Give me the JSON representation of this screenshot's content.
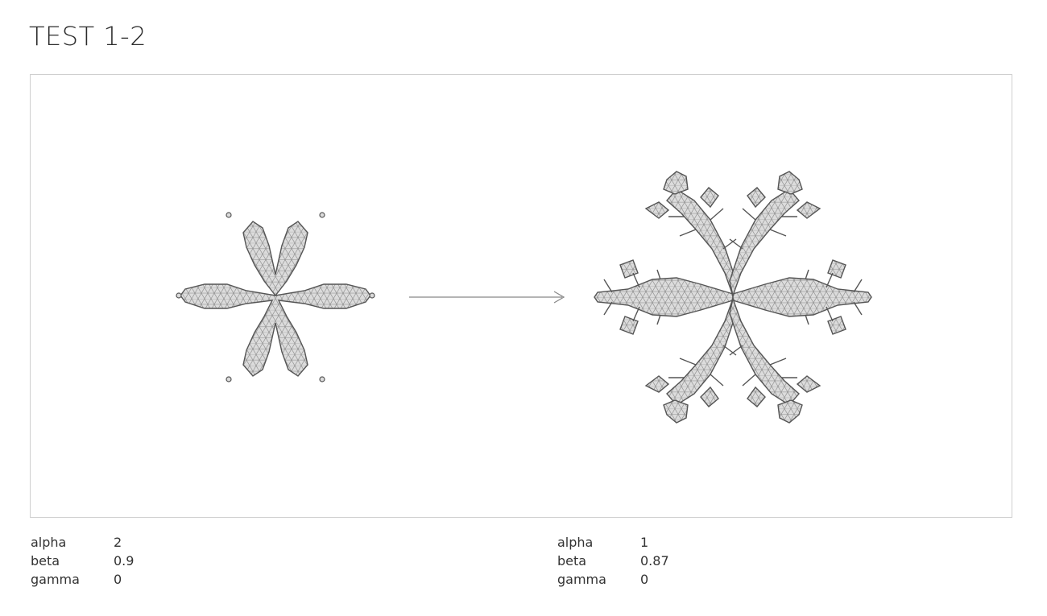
{
  "page": {
    "title": "TEST 1-2"
  },
  "simulations": [
    {
      "params": [
        {
          "key": "alpha",
          "value": "2"
        },
        {
          "key": "beta",
          "value": "0.9"
        },
        {
          "key": "gamma",
          "value": "0"
        }
      ]
    },
    {
      "params": [
        {
          "key": "alpha",
          "value": "1"
        },
        {
          "key": "beta",
          "value": "0.87"
        },
        {
          "key": "gamma",
          "value": "0"
        }
      ]
    }
  ],
  "colors": {
    "crystal_fill": "#dcdcdc",
    "crystal_stroke": "#555555",
    "mesh": "#8a8a8a",
    "arrow": "#888888",
    "frame": "#cfcfcf"
  },
  "icons": {
    "transition": "arrow-right-icon"
  }
}
